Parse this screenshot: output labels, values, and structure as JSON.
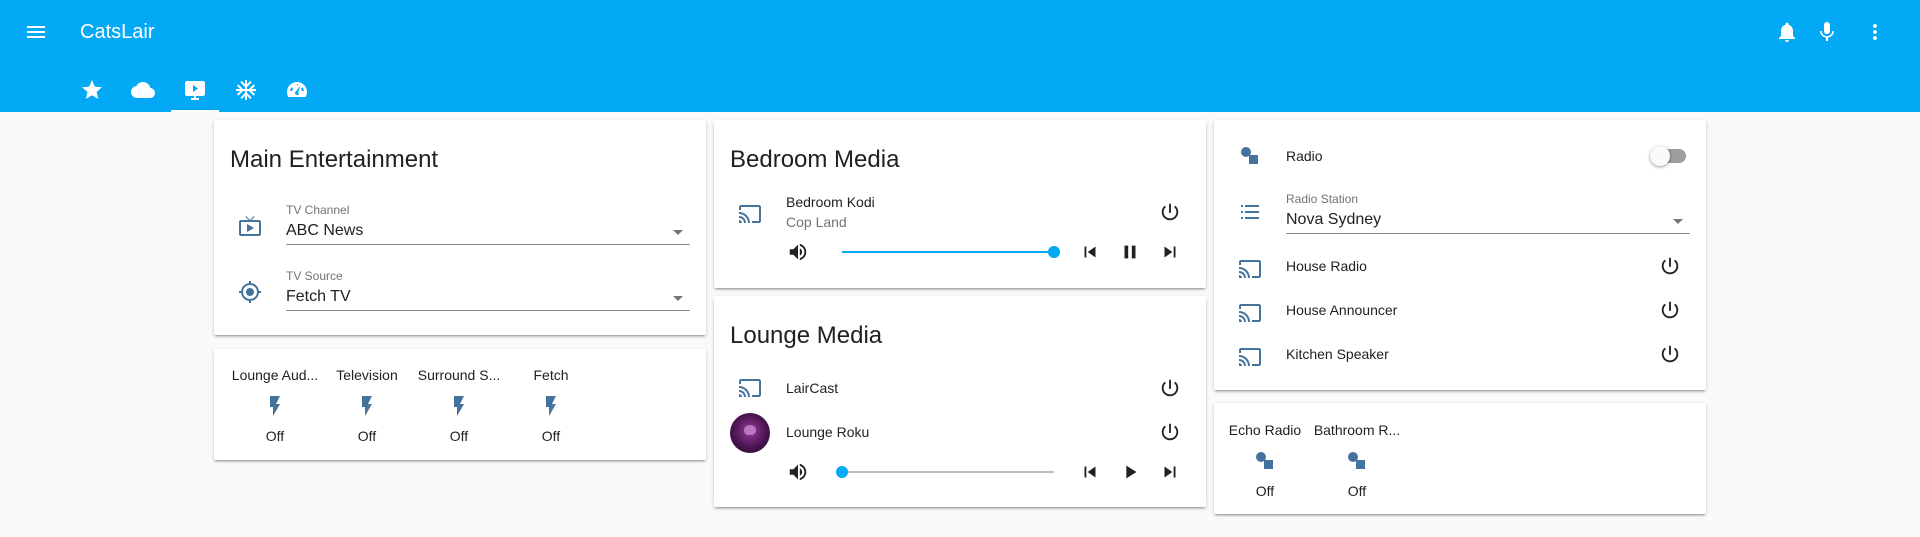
{
  "app": {
    "title": "CatsLair"
  },
  "tabs": [
    {
      "name": "star-icon"
    },
    {
      "name": "cloud-icon"
    },
    {
      "name": "media-icon"
    },
    {
      "name": "snowflake-icon"
    },
    {
      "name": "speedometer-icon"
    }
  ],
  "main_entertainment": {
    "title": "Main Entertainment",
    "tv_channel": {
      "label": "TV Channel",
      "value": "ABC News"
    },
    "tv_source": {
      "label": "TV Source",
      "value": "Fetch TV"
    }
  },
  "lounge_switches": [
    {
      "name": "Lounge Aud...",
      "state": "Off"
    },
    {
      "name": "Television",
      "state": "Off"
    },
    {
      "name": "Surround S...",
      "state": "Off"
    },
    {
      "name": "Fetch",
      "state": "Off"
    }
  ],
  "bedroom_media": {
    "title": "Bedroom Media",
    "player": {
      "name": "Bedroom Kodi",
      "media": "Cop Land",
      "volume": 1.0
    }
  },
  "lounge_media": {
    "title": "Lounge Media",
    "players": [
      {
        "name": "LairCast"
      },
      {
        "name": "Lounge Roku",
        "volume": 0.0
      }
    ]
  },
  "radio": {
    "radio_label": "Radio",
    "station": {
      "label": "Radio Station",
      "value": "Nova Sydney"
    },
    "speakers": [
      {
        "name": "House Radio"
      },
      {
        "name": "House Announcer"
      },
      {
        "name": "Kitchen Speaker"
      }
    ]
  },
  "radio_groups": [
    {
      "name": "Echo Radio",
      "state": "Off"
    },
    {
      "name": "Bathroom R...",
      "state": "Off"
    }
  ],
  "colors": {
    "header": "#03a9f4",
    "accent": "#03a9f4",
    "icon": "#44739e"
  }
}
